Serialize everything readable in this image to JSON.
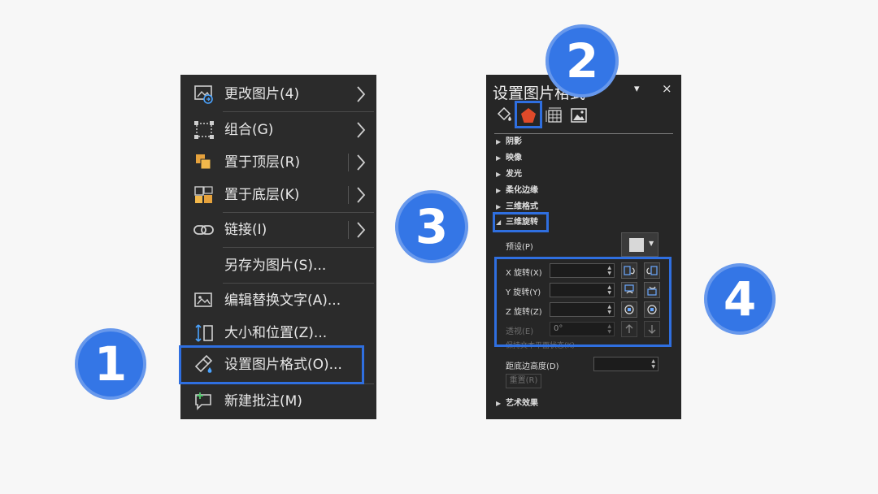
{
  "context_menu": {
    "items": [
      {
        "label": "更改图片(4)",
        "icon": "change-picture-icon",
        "submenu": true
      },
      {
        "label": "组合(G)",
        "icon": "group-icon",
        "submenu": true
      },
      {
        "label": "置于顶层(R)",
        "icon": "bring-to-front-icon",
        "submenu": true
      },
      {
        "label": "置于底层(K)",
        "icon": "send-to-back-icon",
        "submenu": true
      },
      {
        "label": "链接(I)",
        "icon": "link-icon",
        "submenu": true
      },
      {
        "label": "另存为图片(S)...",
        "icon": "",
        "submenu": false
      },
      {
        "label": "编辑替换文字(A)...",
        "icon": "alt-text-icon",
        "submenu": false
      },
      {
        "label": "大小和位置(Z)...",
        "icon": "size-position-icon",
        "submenu": false
      },
      {
        "label": "设置图片格式(O)...",
        "icon": "format-picture-icon",
        "submenu": false
      },
      {
        "label": "新建批注(M)",
        "icon": "new-comment-icon",
        "submenu": false
      }
    ]
  },
  "format_pane": {
    "title": "设置图片格式",
    "pin_glyph": "▾",
    "close_glyph": "×",
    "tabs": [
      "fill-line-icon",
      "effects-icon",
      "size-properties-icon",
      "picture-icon"
    ],
    "sections": {
      "shadow": "阴影",
      "reflection": "映像",
      "glow": "发光",
      "soft_edges": "柔化边缘",
      "format_3d": "三维格式",
      "rotation_3d": "三维旋转",
      "artistic": "艺术效果"
    },
    "preset_label": "预设(P)",
    "x_rotation_label": "X 旋转(X)",
    "y_rotation_label": "Y 旋转(Y)",
    "z_rotation_label": "Z 旋转(Z)",
    "perspective_label": "透视(E)",
    "perspective_value": "0°",
    "keep_text_flat_label": "保持文本平面状态(K)",
    "distance_label": "距底边高度(D)",
    "reset_label": "重置(R)"
  },
  "callouts": [
    "1",
    "2",
    "3",
    "4"
  ],
  "colors": {
    "highlight": "#2f6fe0",
    "circle": "#3476e6",
    "menu_bg": "#2b2b2b",
    "pane_bg": "#262626",
    "effects_tab": "#e04a2a"
  }
}
